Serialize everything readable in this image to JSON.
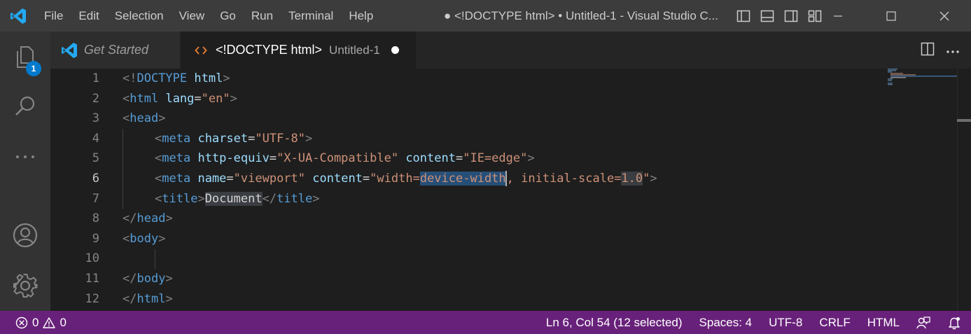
{
  "window": {
    "title": "● <!DOCTYPE html> • Untitled-1 - Visual Studio C...",
    "menu": [
      "File",
      "Edit",
      "Selection",
      "View",
      "Go",
      "Run",
      "Terminal",
      "Help"
    ]
  },
  "activity_bar": {
    "explorer_badge": "1"
  },
  "tabs": [
    {
      "label": "Get Started",
      "icon": "vscode-logo-icon"
    },
    {
      "label": "<!DOCTYPE html>",
      "description": "Untitled-1",
      "icon": "html-code-icon",
      "dirty": true
    }
  ],
  "editor": {
    "line_numbers": [
      "1",
      "2",
      "3",
      "4",
      "5",
      "6",
      "7",
      "8",
      "9",
      "10",
      "11",
      "12"
    ],
    "active_line": "6",
    "code": {
      "l1": {
        "p1": "<!",
        "t": "DOCTYPE",
        "s": " ",
        "a": "html",
        "p2": ">"
      },
      "l2": {
        "p1": "<",
        "t": "html",
        "s": " ",
        "a": "lang",
        "eq": "=",
        "v": "\"en\"",
        "p2": ">"
      },
      "l3": {
        "p1": "<",
        "t": "head",
        "p2": ">"
      },
      "l4": {
        "p1": "<",
        "t": "meta",
        "s": " ",
        "a": "charset",
        "eq": "=",
        "v": "\"UTF-8\"",
        "p2": ">"
      },
      "l5": {
        "p1": "<",
        "t": "meta",
        "s": " ",
        "a1": "http-equiv",
        "eq1": "=",
        "v1": "\"X-UA-Compatible\"",
        "s2": " ",
        "a2": "content",
        "eq2": "=",
        "v2": "\"IE=edge\"",
        "p2": ">"
      },
      "l6": {
        "p1": "<",
        "t": "meta",
        "s": " ",
        "a1": "name",
        "eq1": "=",
        "v1": "\"viewport\"",
        "s2": " ",
        "a2": "content",
        "eq2": "=",
        "v2a": "\"width=",
        "v2sel": "device-width",
        "v2b": ", initial-scale=",
        "v2hl": "1.0",
        "v2c": "\"",
        "p2": ">"
      },
      "l7": {
        "p1": "<",
        "t": "title",
        "p2": ">",
        "text": "Document",
        "p3": "</",
        "t2": "title",
        "p4": ">"
      },
      "l8": {
        "p1": "</",
        "t": "head",
        "p2": ">"
      },
      "l9": {
        "p1": "<",
        "t": "body",
        "p2": ">"
      },
      "l11": {
        "p1": "</",
        "t": "body",
        "p2": ">"
      },
      "l12": {
        "p1": "</",
        "t": "html",
        "p2": ">"
      }
    }
  },
  "status_bar": {
    "errors": "0",
    "warnings": "0",
    "position": "Ln 6, Col 54 (12 selected)",
    "indent": "Spaces: 4",
    "encoding": "UTF-8",
    "eol": "CRLF",
    "language": "HTML"
  },
  "colors": {
    "status_bar": "#68217a",
    "accent": "#007acc"
  }
}
